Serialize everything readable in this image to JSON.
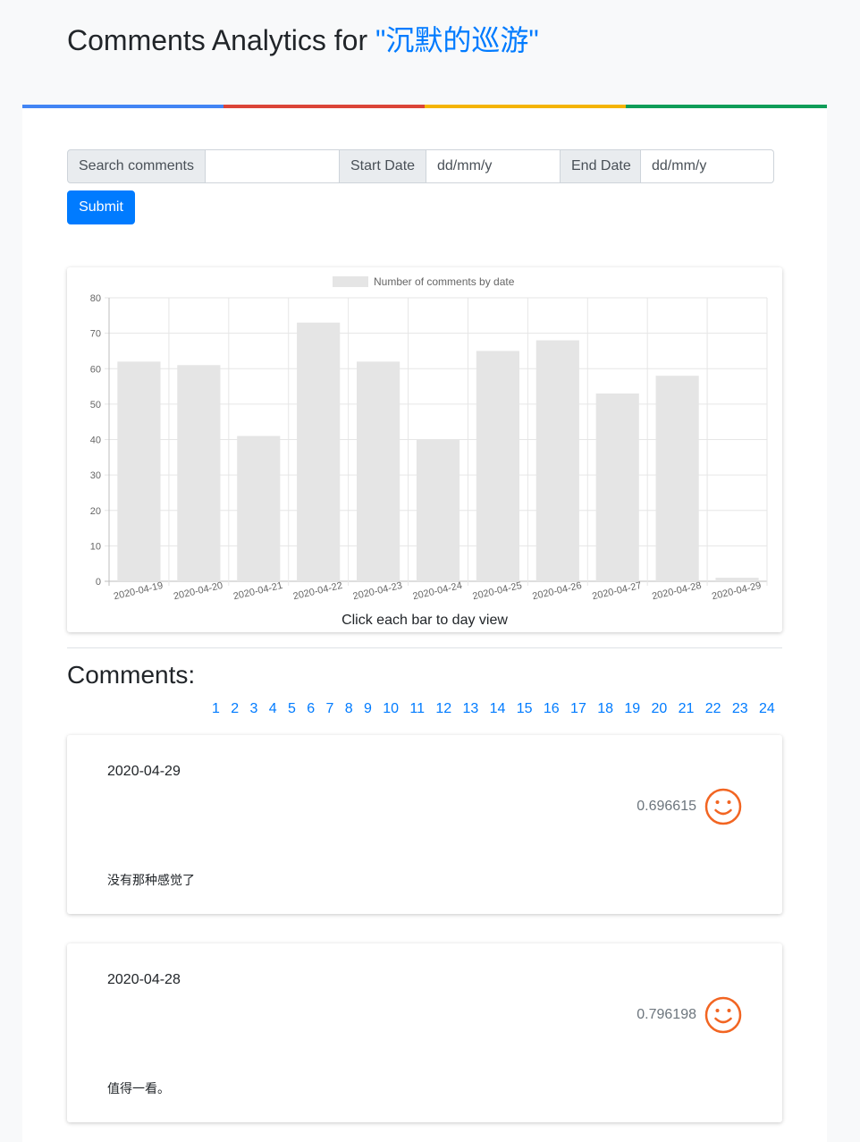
{
  "header": {
    "title_prefix": "Comments Analytics for ",
    "movie_title": "\"沉默的巡游\""
  },
  "accent_colors": [
    "#4285f4",
    "#db4437",
    "#f4b400",
    "#0f9d58"
  ],
  "search": {
    "search_label": "Search comments",
    "search_value": "",
    "start_label": "Start Date",
    "start_placeholder": "dd/mm/y",
    "end_label": "End Date",
    "end_placeholder": "dd/mm/y",
    "submit_label": "Submit"
  },
  "chart_data": {
    "type": "bar",
    "legend": "Number of comments by date",
    "legend_position": "top",
    "categories": [
      "2020-04-19",
      "2020-04-20",
      "2020-04-21",
      "2020-04-22",
      "2020-04-23",
      "2020-04-24",
      "2020-04-25",
      "2020-04-26",
      "2020-04-27",
      "2020-04-28",
      "2020-04-29"
    ],
    "values": [
      62,
      61,
      41,
      73,
      62,
      40,
      65,
      68,
      53,
      58,
      1
    ],
    "ylim": [
      0,
      80
    ],
    "yticks": [
      0,
      10,
      20,
      30,
      40,
      50,
      60,
      70,
      80
    ],
    "grid": true,
    "bar_color": "#e5e5e5",
    "caption": "Click each bar to day view"
  },
  "comments_section": {
    "heading": "Comments:",
    "pages": [
      "1",
      "2",
      "3",
      "4",
      "5",
      "6",
      "7",
      "8",
      "9",
      "10",
      "11",
      "12",
      "13",
      "14",
      "15",
      "16",
      "17",
      "18",
      "19",
      "20",
      "21",
      "22",
      "23",
      "24"
    ]
  },
  "comments": [
    {
      "date": "2020-04-29",
      "score": "0.696615",
      "text": "没有那种感觉了",
      "sentiment_icon": "smiley-icon"
    },
    {
      "date": "2020-04-28",
      "score": "0.796198",
      "text": "值得一看。",
      "sentiment_icon": "smiley-icon"
    }
  ],
  "smiley_color": "#f26522"
}
